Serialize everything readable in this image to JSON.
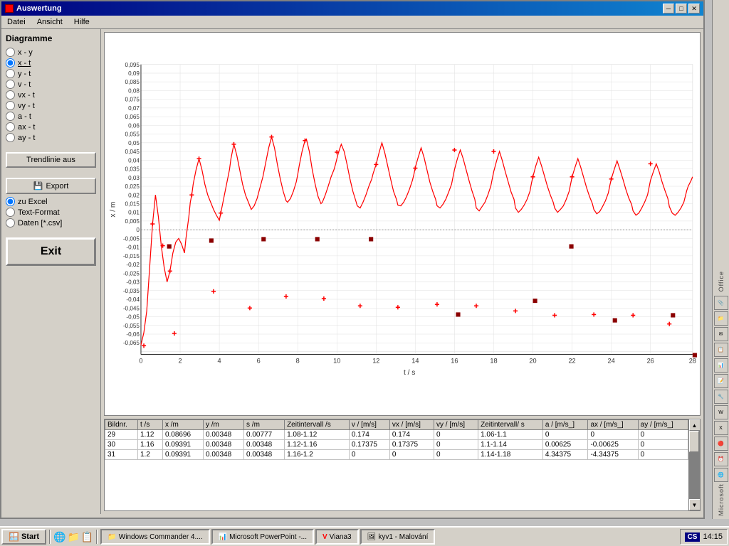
{
  "window": {
    "title": "Auswertung",
    "close_btn": "✕",
    "maximize_btn": "□",
    "minimize_btn": "─"
  },
  "menu": {
    "items": [
      "Datei",
      "Ansicht",
      "Hilfe"
    ]
  },
  "left_panel": {
    "title": "Diagramme",
    "radio_options": [
      {
        "id": "xy",
        "label": "x - y",
        "selected": false
      },
      {
        "id": "xt",
        "label": "x - t",
        "selected": true
      },
      {
        "id": "yt",
        "label": "y - t",
        "selected": false
      },
      {
        "id": "vt",
        "label": "v - t",
        "selected": false
      },
      {
        "id": "vxt",
        "label": "vx - t",
        "selected": false
      },
      {
        "id": "vyt",
        "label": "vy - t",
        "selected": false
      },
      {
        "id": "at",
        "label": "a - t",
        "selected": false
      },
      {
        "id": "axt",
        "label": "ax - t",
        "selected": false
      },
      {
        "id": "ayt",
        "label": "ay - t",
        "selected": false
      }
    ],
    "trendline_btn": "Trendlinie aus",
    "export_btn": "Export",
    "export_options": [
      {
        "id": "excel",
        "label": "zu Excel",
        "selected": true
      },
      {
        "id": "text",
        "label": "Text-Format",
        "selected": false
      },
      {
        "id": "csv",
        "label": "Daten [*.csv]",
        "selected": false
      }
    ],
    "exit_btn": "Exit"
  },
  "chart": {
    "y_label": "x / m",
    "x_label": "t / s",
    "y_max": "0,095",
    "y_min": "-0,065",
    "x_max": "28",
    "x_ticks": [
      "0",
      "2",
      "4",
      "6",
      "8",
      "10",
      "12",
      "14",
      "16",
      "18",
      "20",
      "22",
      "24",
      "26",
      "28"
    ],
    "y_ticks": [
      "0,095",
      "0,09",
      "0,085",
      "0,08",
      "0,075",
      "0,07",
      "0,065",
      "0,06",
      "0,055",
      "0,05",
      "0,045",
      "0,04",
      "0,035",
      "0,03",
      "0,025",
      "0,02",
      "0,015",
      "0,01",
      "0,005",
      "0",
      "-0,005",
      "-0,01",
      "-0,015",
      "-0,02",
      "-0,025",
      "-0,03",
      "-0,035",
      "-0,04",
      "-0,045",
      "-0,05",
      "-0,055",
      "-0,06",
      "-0,065"
    ]
  },
  "table": {
    "headers": [
      "Bildnr.",
      "t /s",
      "x /m",
      "y /m",
      "s /m",
      "Zeitintervall /s",
      "v / [m/s]",
      "vx / [m/s]",
      "vy / [m/s]",
      "Zeitintervall/ s",
      "a / [m/s_]",
      "ax / [m/s_]",
      "ay / [m/s_]"
    ],
    "rows": [
      [
        "29",
        "1.12",
        "0.08696",
        "0.00348",
        "0.00777",
        "1.08-1.12",
        "0.174",
        "0.174",
        "0",
        "1.06-1.1",
        "0",
        "0",
        "0"
      ],
      [
        "30",
        "1.16",
        "0.09391",
        "0.00348",
        "0.00348",
        "1.12-1.16",
        "0.17375",
        "0.17375",
        "0",
        "1.1-1.14",
        "0.00625",
        "-0.00625",
        "0"
      ],
      [
        "31",
        "1.2",
        "0.09391",
        "0.00348",
        "0.00348",
        "1.16-1.2",
        "0",
        "0",
        "0",
        "1.14-1.18",
        "4.34375",
        "-4.34375",
        "0"
      ]
    ]
  },
  "taskbar": {
    "start_label": "Start",
    "buttons": [
      {
        "label": "Windows Commander 4....",
        "active": false,
        "icon": "📁"
      },
      {
        "label": "Microsoft PowerPoint -...",
        "active": false,
        "icon": "📊"
      },
      {
        "label": "Viana3",
        "active": true,
        "icon": "V"
      },
      {
        "label": "kyv1 - Malování",
        "active": false,
        "icon": "🖼"
      }
    ],
    "lang": "CS",
    "time": "14:15"
  },
  "office_bar": {
    "label": "Microsoft",
    "label2": "Office"
  }
}
